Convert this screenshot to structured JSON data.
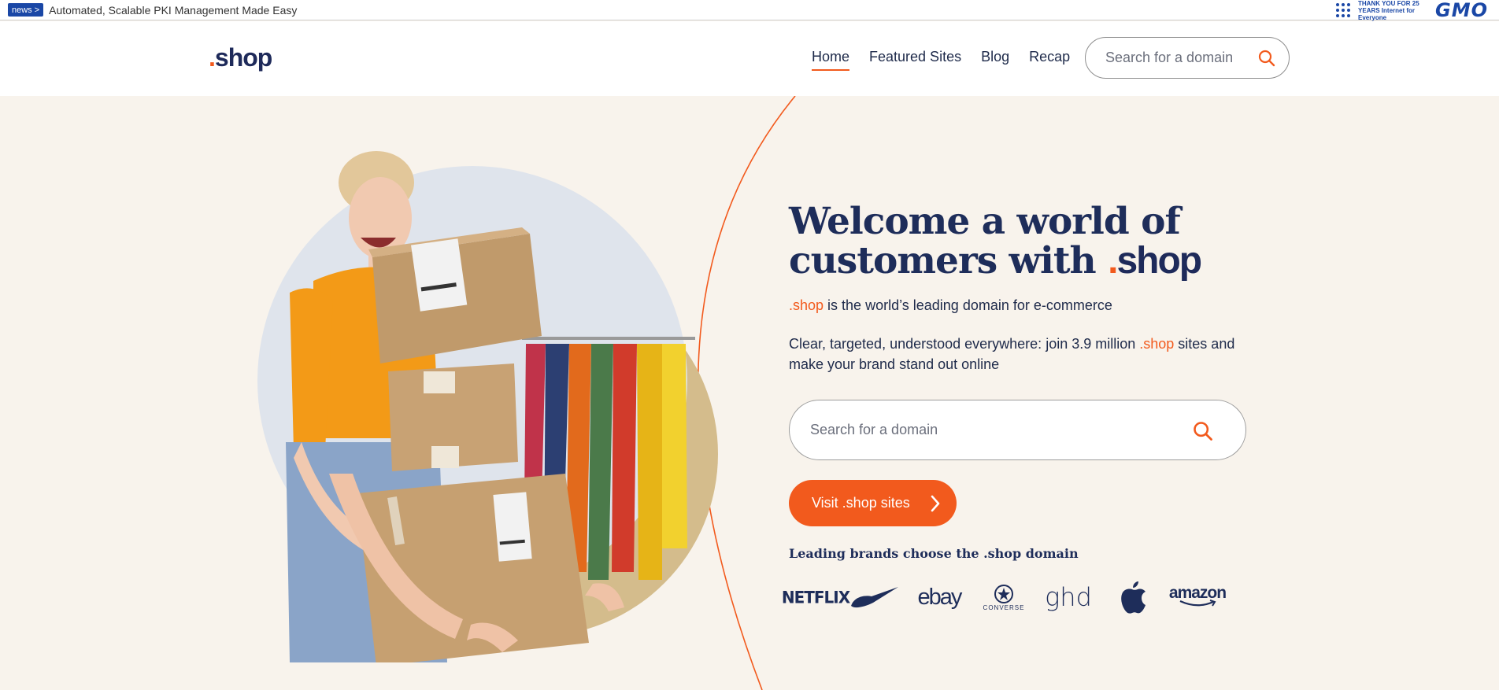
{
  "topbar": {
    "news_badge": "news >",
    "news_text": "Automated, Scalable PKI Management Made Easy",
    "gmo_tagline": "THANK YOU FOR 25 YEARS Internet for Everyone",
    "gmo_logo": "GMO"
  },
  "header": {
    "logo_dot": ".",
    "logo_text": "shop",
    "nav": [
      {
        "label": "Home",
        "active": true
      },
      {
        "label": "Featured Sites"
      },
      {
        "label": "Blog"
      },
      {
        "label": "Recap"
      }
    ],
    "search_placeholder": "Search for a domain"
  },
  "hero": {
    "headline_line1": "Welcome a world of",
    "headline_line2": "customers with ",
    "headline_shop_dot": ".",
    "headline_shop": "shop",
    "tagline_brand": ".shop",
    "tagline_rest": " is the world’s leading domain for e-commerce",
    "desc_part1": "Clear, targeted, understood everywhere: join 3.9 million ",
    "desc_brand": ".shop",
    "desc_part2": " sites and make your brand stand out online",
    "search_placeholder": "Search for a domain",
    "visit_button": "Visit .shop sites",
    "brands_title": "Leading brands choose the .shop domain",
    "brands": {
      "netflix": "NETFLIX",
      "ebay": "ebay",
      "converse": "CONVERSE",
      "ghd": "ghd",
      "amazon": "amazon"
    }
  },
  "colors": {
    "accent": "#f25a1d",
    "navy": "#1e2d5a",
    "background": "#f8f3ec",
    "circle": "#dfe4ec",
    "tan": "#d4bc8c"
  }
}
